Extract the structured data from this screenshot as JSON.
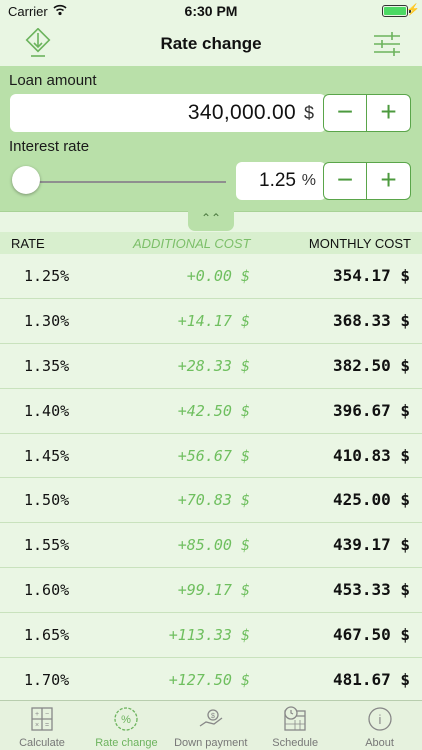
{
  "status": {
    "carrier": "Carrier",
    "time": "6:30 PM"
  },
  "navbar": {
    "title": "Rate change",
    "left_icon": "download-icon",
    "right_icon": "settings-sliders-icon"
  },
  "loan": {
    "label": "Loan amount",
    "value": "340,000.00",
    "unit": "$"
  },
  "interest": {
    "label": "Interest rate",
    "value": "1.25",
    "unit": "%",
    "slider_fraction": 0
  },
  "stepper": {
    "minus": "−",
    "plus": "+"
  },
  "collapse_symbol": "⌃⌃",
  "table": {
    "headers": {
      "rate": "RATE",
      "additional": "ADDITIONAL COST",
      "monthly": "MONTHLY COST"
    },
    "rows": [
      {
        "rate": "1.25%",
        "additional": "+0.00 $",
        "monthly": "354.17 $"
      },
      {
        "rate": "1.30%",
        "additional": "+14.17 $",
        "monthly": "368.33 $"
      },
      {
        "rate": "1.35%",
        "additional": "+28.33 $",
        "monthly": "382.50 $"
      },
      {
        "rate": "1.40%",
        "additional": "+42.50 $",
        "monthly": "396.67 $"
      },
      {
        "rate": "1.45%",
        "additional": "+56.67 $",
        "monthly": "410.83 $"
      },
      {
        "rate": "1.50%",
        "additional": "+70.83 $",
        "monthly": "425.00 $"
      },
      {
        "rate": "1.55%",
        "additional": "+85.00 $",
        "monthly": "439.17 $"
      },
      {
        "rate": "1.60%",
        "additional": "+99.17 $",
        "monthly": "453.33 $"
      },
      {
        "rate": "1.65%",
        "additional": "+113.33 $",
        "monthly": "467.50 $"
      },
      {
        "rate": "1.70%",
        "additional": "+127.50 $",
        "monthly": "481.67 $"
      }
    ]
  },
  "tabs": [
    {
      "label": "Calculate",
      "icon": "calculator-icon",
      "active": false
    },
    {
      "label": "Rate change",
      "icon": "percent-icon",
      "active": true
    },
    {
      "label": "Down payment",
      "icon": "hand-money-icon",
      "active": false
    },
    {
      "label": "Schedule",
      "icon": "calendar-clock-icon",
      "active": false
    },
    {
      "label": "About",
      "icon": "info-icon",
      "active": false
    }
  ],
  "colors": {
    "accent": "#6cb35d",
    "panel": "#b9e0a9",
    "background": "#e9f6e3",
    "additional_text": "#6fbf5f"
  }
}
